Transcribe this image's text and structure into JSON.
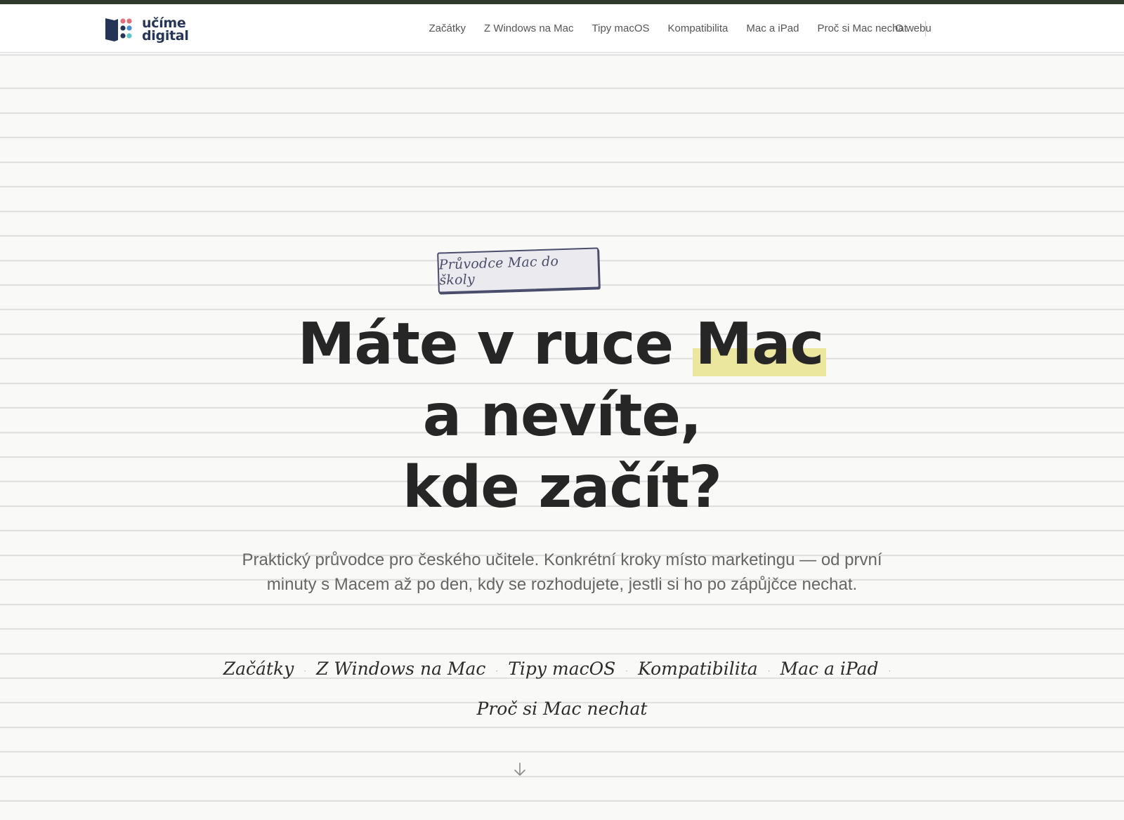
{
  "header": {
    "logo": {
      "line1": "učíme",
      "line2": "digital",
      "colors": {
        "book": "#243457",
        "dot_red": "#e0707a",
        "dot_blue": "#4a8ed0",
        "dot_teal": "#5cc6c4"
      }
    },
    "nav": [
      {
        "label": "Začátky"
      },
      {
        "label": "Z Windows na Mac"
      },
      {
        "label": "Tipy macOS"
      },
      {
        "label": "Kompatibilita"
      },
      {
        "label": "Mac a iPad"
      },
      {
        "label": "Proč si Mac nechat"
      }
    ],
    "about": "O webu"
  },
  "hero": {
    "badge": "Průvodce Mac do školy",
    "title": {
      "line1_before": "Máte v ruce",
      "line1_highlight": "Mac",
      "line2": "a nevíte,",
      "line3": "kde začít?"
    },
    "highlight_color": "#ebe79f",
    "lead": "Praktický průvodce pro českého učitele. Konkrétní kroky místo marketingu — od první minuty s Macem až po den, kdy se rozhodujete, jestli si ho po zápůjčce nechat.",
    "section_links": [
      {
        "label": "Začátky"
      },
      {
        "label": "Z Windows na Mac"
      },
      {
        "label": "Tipy macOS"
      },
      {
        "label": "Kompatibilita"
      },
      {
        "label": "Mac a iPad"
      },
      {
        "label": "Proč si Mac nechat"
      }
    ],
    "scroll_icon": "arrow-down-icon"
  }
}
